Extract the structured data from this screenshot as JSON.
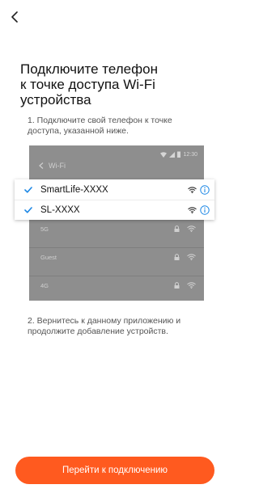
{
  "page": {
    "title": "Подключите телефон\nк точке доступа Wi-Fi\nустройства",
    "step1": "1. Подключите свой телефон к точке\nдоступа, указанной ниже.",
    "step2": "2. Вернитесь к данному приложению и\nпродолжите добавление устройств.",
    "button_label": "Перейти к подключению",
    "accent_color": "#ff5a1f",
    "link_color": "#1e88e5"
  },
  "phone": {
    "time": "12:30",
    "header": "Wi-Fi",
    "networks": [
      {
        "name": "5G",
        "icons": [
          "lock-icon",
          "wifi-icon"
        ]
      },
      {
        "name": "Guest",
        "icons": [
          "lock-icon",
          "wifi-icon"
        ]
      },
      {
        "name": "4G",
        "icons": [
          "lock-icon",
          "wifi-icon"
        ]
      }
    ]
  },
  "highlight": {
    "networks": [
      {
        "name": "SmartLife-XXXX",
        "checked": true,
        "icons": [
          "wifi-icon",
          "info-icon"
        ]
      },
      {
        "name": "SL-XXXX",
        "checked": true,
        "icons": [
          "wifi-icon",
          "info-icon"
        ]
      }
    ]
  }
}
